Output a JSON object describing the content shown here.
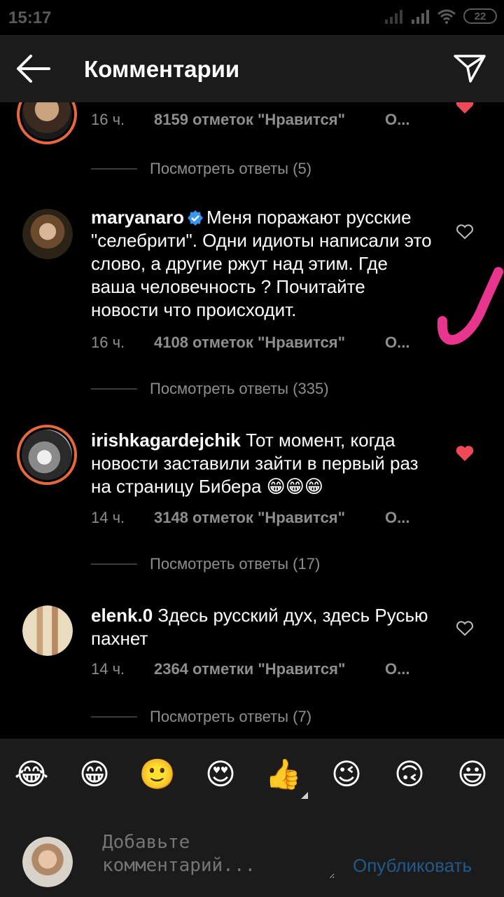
{
  "status_bar": {
    "time": "15:17",
    "battery": "22"
  },
  "header": {
    "title": "Комментарии"
  },
  "comments": [
    {
      "username": "",
      "text": "",
      "time": "16 ч.",
      "likes": "8159 отметок \"Нравится\"",
      "reply": "О...",
      "liked": true,
      "view_replies": "Посмотреть ответы (5)"
    },
    {
      "username": "maryanaro",
      "verified": true,
      "text": "Меня поражают русские \"селебрити\". Одни идиоты написали это слово, а другие ржут над этим. Где ваша человечность ? Почитайте новости что происходит.",
      "time": "16 ч.",
      "likes": "4108 отметок \"Нравится\"",
      "reply": "О...",
      "liked": false,
      "view_replies": "Посмотреть ответы (335)"
    },
    {
      "username": "irishkagardejchik",
      "text": "Тот момент, когда новости заставили зайти в первый раз  на страницу Бибера 😁😁😁",
      "time": "14 ч.",
      "likes": "3148 отметок \"Нравится\"",
      "reply": "О...",
      "liked": true,
      "view_replies": "Посмотреть ответы (17)"
    },
    {
      "username": "elenk.0",
      "text": "Здесь русский дух, здесь Русью пахнет",
      "time": "14 ч.",
      "likes": "2364 отметки \"Нравится\"",
      "reply": "О...",
      "liked": false,
      "view_replies": "Посмотреть ответы (7)"
    }
  ],
  "emoji_bar": [
    "😂",
    "😁",
    "🙂",
    "😍",
    "👍",
    "😉",
    "🙃",
    "😃"
  ],
  "composer": {
    "placeholder": "Добавьте комментарий...",
    "publish_label": "Опубликовать"
  },
  "colors": {
    "background": "#000000",
    "panel": "#1b1b1b",
    "heart_liked": "#ed4956",
    "secondary_text": "#8e8e8e",
    "publish_link": "#1f5a8a",
    "annotation": "#e8368f"
  }
}
